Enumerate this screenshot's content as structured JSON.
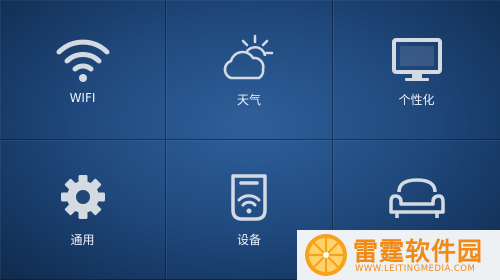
{
  "tiles": [
    {
      "label": "WIFI",
      "icon": "wifi-icon"
    },
    {
      "label": "天气",
      "icon": "weather-icon"
    },
    {
      "label": "个性化",
      "icon": "monitor-icon"
    },
    {
      "label": "通用",
      "icon": "gear-icon"
    },
    {
      "label": "设备",
      "icon": "device-icon"
    },
    {
      "label": "",
      "icon": "sofa-icon"
    }
  ],
  "watermark": {
    "name": "雷霆软件园",
    "url": "WWW.LEITINGMEDIA.COM",
    "icon": "orange-slice-logo"
  },
  "colors": {
    "background": "#1d4576",
    "icon": "#d4dae2",
    "text": "#eef3fa",
    "watermark": "#f08a14"
  }
}
